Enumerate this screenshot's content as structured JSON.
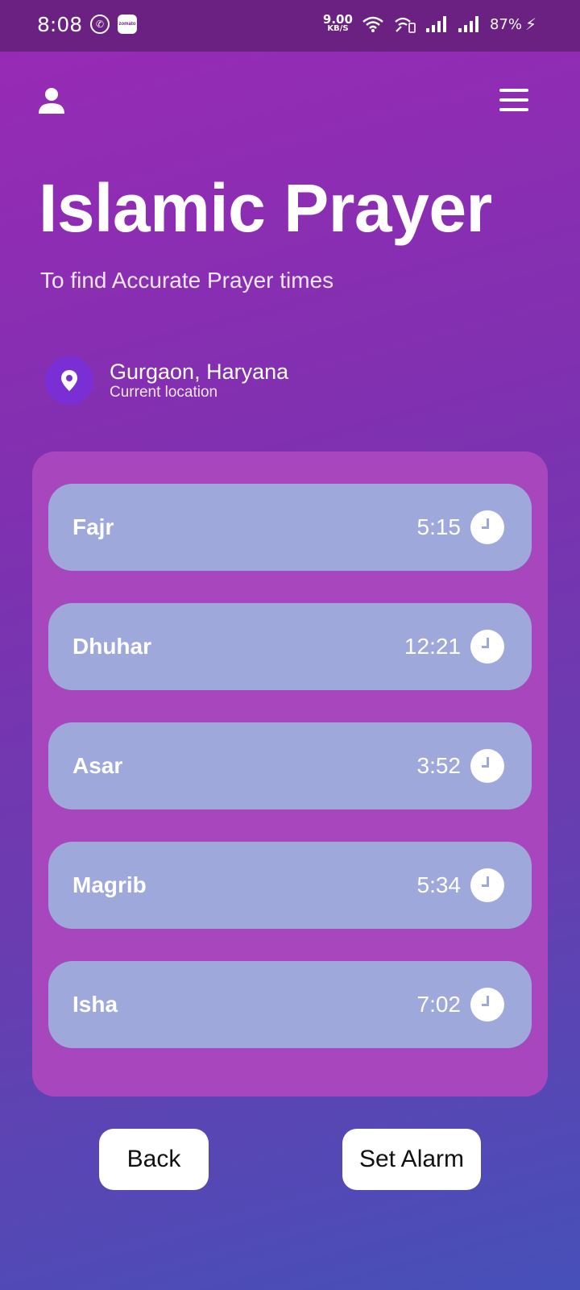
{
  "status_bar": {
    "time": "8:08",
    "net_speed_value": "9.00",
    "net_speed_unit": "KB/S",
    "battery": "87%",
    "icons": [
      "whatsapp-icon",
      "zomato-icon",
      "wifi-icon",
      "volte-wifi-icon",
      "signal-icon",
      "signal-icon",
      "charging-bolt-icon"
    ]
  },
  "header": {
    "title": "Islamic Prayer",
    "subtitle": "To find Accurate Prayer times",
    "profile_icon": "person-icon",
    "menu_icon": "hamburger-menu-icon"
  },
  "location": {
    "city": "Gurgaon, Haryana",
    "label": "Current location",
    "icon": "location-pin-icon"
  },
  "prayers": [
    {
      "name": "Fajr",
      "time": "5:15"
    },
    {
      "name": "Dhuhar",
      "time": "12:21"
    },
    {
      "name": "Asar",
      "time": "3:52"
    },
    {
      "name": "Magrib",
      "time": "5:34"
    },
    {
      "name": "Isha",
      "time": "7:02"
    }
  ],
  "actions": {
    "back_label": "Back",
    "set_alarm_label": "Set Alarm"
  },
  "colors": {
    "status_bar_bg": "#6a2182",
    "card_bg": "#a846bd",
    "row_bg": "#9ea8da",
    "pin_bg": "#7a2fd4",
    "gradient_top": "#9a2ab6",
    "gradient_bottom": "#4650b8"
  }
}
